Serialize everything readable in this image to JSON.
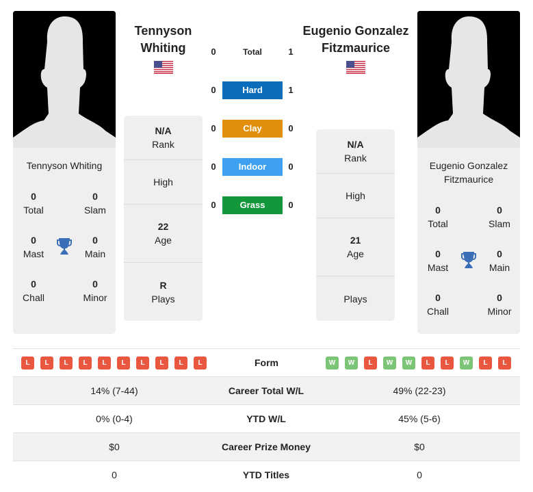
{
  "players": {
    "left": {
      "name": "Tennyson Whiting",
      "title_line1": "Tennyson",
      "title_line2": "Whiting",
      "country_flag": "us-flag-icon",
      "card_name_line1": "Tennyson Whiting",
      "card_name_line2": "",
      "titles": {
        "total": {
          "value": "0",
          "label": "Total"
        },
        "slam": {
          "value": "0",
          "label": "Slam"
        },
        "mast": {
          "value": "0",
          "label": "Mast"
        },
        "main": {
          "value": "0",
          "label": "Main"
        },
        "chall": {
          "value": "0",
          "label": "Chall"
        },
        "minor": {
          "value": "0",
          "label": "Minor"
        }
      },
      "stats": [
        {
          "value": "N/A",
          "label": "Rank"
        },
        {
          "value": "",
          "label": "High"
        },
        {
          "value": "22",
          "label": "Age"
        },
        {
          "value": "R",
          "label": "Plays"
        }
      ],
      "form": [
        "L",
        "L",
        "L",
        "L",
        "L",
        "L",
        "L",
        "L",
        "L",
        "L"
      ]
    },
    "right": {
      "name": "Eugenio Gonzalez Fitzmaurice",
      "title_line1": "Eugenio Gonzalez",
      "title_line2": "Fitzmaurice",
      "country_flag": "us-flag-icon",
      "card_name_line1": "Eugenio Gonzalez",
      "card_name_line2": "Fitzmaurice",
      "titles": {
        "total": {
          "value": "0",
          "label": "Total"
        },
        "slam": {
          "value": "0",
          "label": "Slam"
        },
        "mast": {
          "value": "0",
          "label": "Mast"
        },
        "main": {
          "value": "0",
          "label": "Main"
        },
        "chall": {
          "value": "0",
          "label": "Chall"
        },
        "minor": {
          "value": "0",
          "label": "Minor"
        }
      },
      "stats": [
        {
          "value": "N/A",
          "label": "Rank"
        },
        {
          "value": "",
          "label": "High"
        },
        {
          "value": "21",
          "label": "Age"
        },
        {
          "value": "",
          "label": "Plays"
        }
      ],
      "form": [
        "W",
        "W",
        "L",
        "W",
        "W",
        "L",
        "L",
        "W",
        "L",
        "L"
      ]
    }
  },
  "h2h": [
    {
      "label": "Total",
      "left": "0",
      "right": "1",
      "color": null
    },
    {
      "label": "Hard",
      "left": "0",
      "right": "1",
      "color": "#0a6ebd"
    },
    {
      "label": "Clay",
      "left": "0",
      "right": "0",
      "color": "#e08e0b"
    },
    {
      "label": "Indoor",
      "left": "0",
      "right": "0",
      "color": "#3da0f0"
    },
    {
      "label": "Grass",
      "left": "0",
      "right": "0",
      "color": "#12973a"
    }
  ],
  "form_label": "Form",
  "comparison": [
    {
      "label": "Career Total W/L",
      "left": "14% (7-44)",
      "right": "49% (22-23)"
    },
    {
      "label": "YTD W/L",
      "left": "0% (0-4)",
      "right": "45% (5-6)"
    },
    {
      "label": "Career Prize Money",
      "left": "$0",
      "right": "$0"
    },
    {
      "label": "YTD Titles",
      "left": "0",
      "right": "0"
    }
  ],
  "colors": {
    "loss": "#e9573f",
    "win": "#7cc576",
    "trophy": "#3a6fb7"
  }
}
